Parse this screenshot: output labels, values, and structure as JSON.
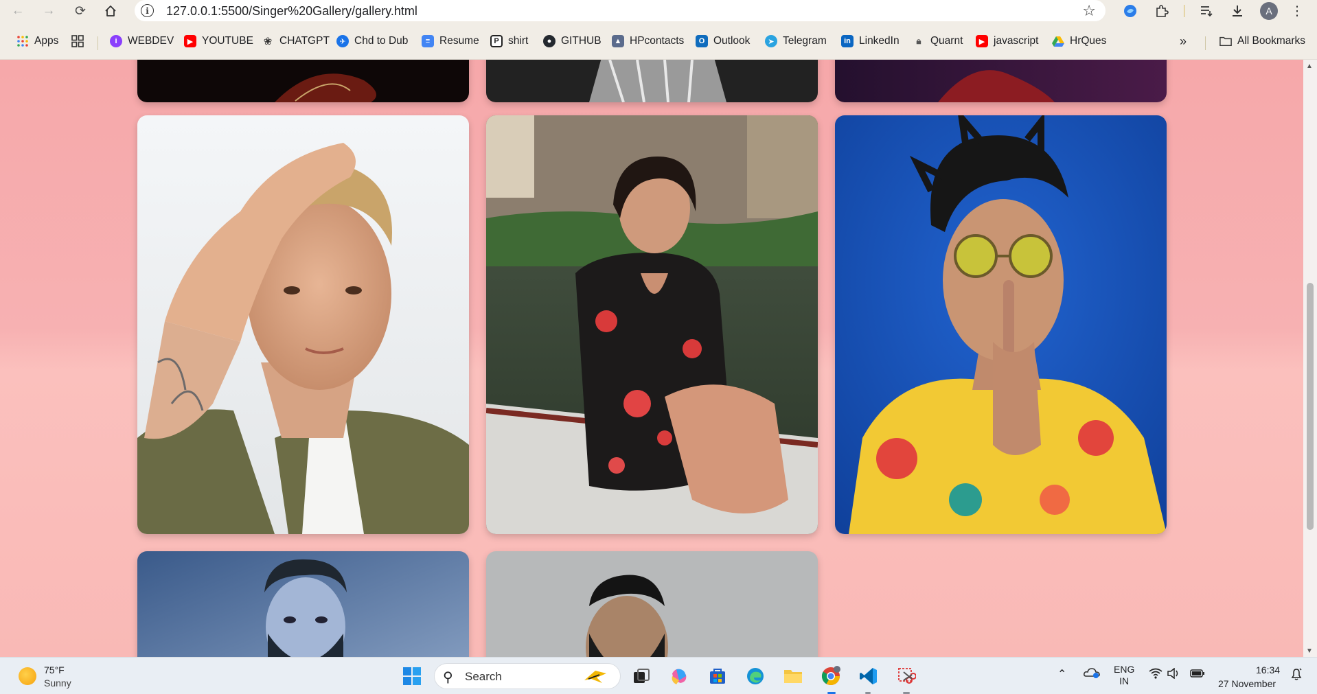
{
  "browser": {
    "url": "127.0.0.1:5500/Singer%20Gallery/gallery.html",
    "avatar_letter": "A",
    "bookmarks": [
      {
        "label": "Apps",
        "icon": "apps-grid-icon"
      },
      {
        "label": "WEBDEV",
        "icon": "webdev-icon"
      },
      {
        "label": "YOUTUBE",
        "icon": "youtube-icon"
      },
      {
        "label": "CHATGPT",
        "icon": "chatgpt-icon"
      },
      {
        "label": "Chd to Dub",
        "icon": "plane-icon"
      },
      {
        "label": "Resume",
        "icon": "doc-icon"
      },
      {
        "label": "shirt",
        "icon": "shirt-icon"
      },
      {
        "label": "GITHUB",
        "icon": "github-icon"
      },
      {
        "label": "HPcontacts",
        "icon": "hp-icon"
      },
      {
        "label": "Outlook",
        "icon": "outlook-icon"
      },
      {
        "label": "Telegram",
        "icon": "telegram-icon"
      },
      {
        "label": "LinkedIn",
        "icon": "linkedin-icon"
      },
      {
        "label": "Quarnt",
        "icon": "lock-icon"
      },
      {
        "label": "javascript",
        "icon": "youtube-icon"
      },
      {
        "label": "HrQues",
        "icon": "drive-icon"
      }
    ],
    "all_bookmarks": "All Bookmarks"
  },
  "gallery": {
    "photos": [
      {
        "subject": "singer-1",
        "colors": [
          "#2a0b0b",
          "#6a1b12"
        ]
      },
      {
        "subject": "singer-2",
        "colors": [
          "#2c2c2c",
          "#9a9a9a"
        ]
      },
      {
        "subject": "singer-3",
        "colors": [
          "#2a1030",
          "#6b1a2c"
        ]
      },
      {
        "subject": "singer-4",
        "colors": [
          "#eceef0",
          "#6d6a48"
        ]
      },
      {
        "subject": "singer-5",
        "colors": [
          "#5a6a4c",
          "#b5303a"
        ]
      },
      {
        "subject": "singer-6",
        "colors": [
          "#1a4aa3",
          "#e8b227"
        ]
      },
      {
        "subject": "singer-7",
        "colors": [
          "#3d5a86",
          "#a9b8cf"
        ]
      },
      {
        "subject": "singer-8",
        "colors": [
          "#b7b9ba",
          "#a8aaac"
        ]
      }
    ]
  },
  "taskbar": {
    "weather_temp": "75°F",
    "weather_desc": "Sunny",
    "search_label": "Search",
    "lang_line1": "ENG",
    "lang_line2": "IN",
    "time": "16:34",
    "date": "27 November"
  }
}
